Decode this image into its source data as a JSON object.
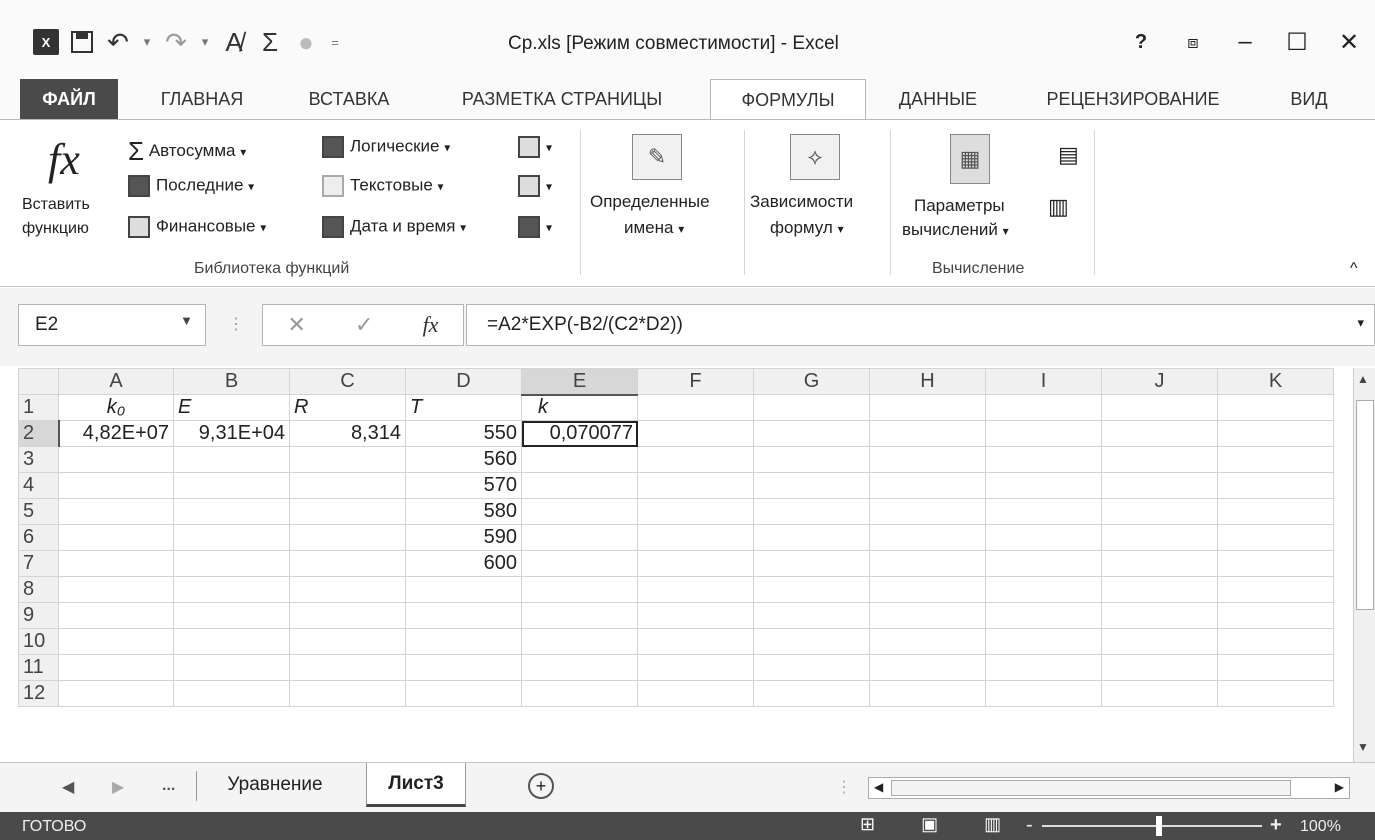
{
  "window": {
    "title": "Ср.xls  [Режим совместимости] - Excel",
    "help": "?",
    "restore_ribbon": "⧈",
    "minimize": "–",
    "maximize": "☐",
    "close": "✕"
  },
  "qat": {
    "logo": "X",
    "save": "💾",
    "undo": "↶",
    "redo": "↷",
    "spell": "A̸",
    "sum": "Σ",
    "circle": "●",
    "more": "="
  },
  "tabs": [
    "ФАЙЛ",
    "ГЛАВНАЯ",
    "ВСТАВКА",
    "РАЗМЕТКА СТРАНИЦЫ",
    "ФОРМУЛЫ",
    "ДАННЫЕ",
    "РЕЦЕНЗИРОВАНИЕ",
    "ВИД"
  ],
  "ribbon": {
    "insert_fn_line1": "Вставить",
    "insert_fn_line2": "функцию",
    "fx": "fx",
    "autosum": "Автосумма",
    "recent": "Последние",
    "financial": "Финансовые",
    "logical": "Логические",
    "text": "Текстовые",
    "datetime": "Дата и время",
    "group_library": "Библиотека функций",
    "defined_names_1": "Определенные",
    "defined_names_2": "имена",
    "dependencies_1": "Зависимости",
    "dependencies_2": "формул",
    "calc_params_1": "Параметры",
    "calc_params_2": "вычислений",
    "group_calc": "Вычисление",
    "collapse": "^"
  },
  "formula_bar": {
    "name_box": "E2",
    "formula": "=A2*EXP(-B2/(C2*D2))",
    "fx": "fx",
    "cancel": "✕",
    "enter": "✓"
  },
  "grid": {
    "columns": [
      "A",
      "B",
      "C",
      "D",
      "E",
      "F",
      "G",
      "H",
      "I",
      "J",
      "K"
    ],
    "rows": [
      [
        "k₀",
        "E",
        "R",
        "T",
        "k",
        "",
        "",
        "",
        "",
        "",
        ""
      ],
      [
        "4,82E+07",
        "9,31E+04",
        "8,314",
        "550",
        "0,070077",
        "",
        "",
        "",
        "",
        "",
        ""
      ],
      [
        "",
        "",
        "",
        "560",
        "",
        "",
        "",
        "",
        "",
        "",
        ""
      ],
      [
        "",
        "",
        "",
        "570",
        "",
        "",
        "",
        "",
        "",
        "",
        ""
      ],
      [
        "",
        "",
        "",
        "580",
        "",
        "",
        "",
        "",
        "",
        "",
        ""
      ],
      [
        "",
        "",
        "",
        "590",
        "",
        "",
        "",
        "",
        "",
        "",
        ""
      ],
      [
        "",
        "",
        "",
        "600",
        "",
        "",
        "",
        "",
        "",
        "",
        ""
      ],
      [
        "",
        "",
        "",
        "",
        "",
        "",
        "",
        "",
        "",
        "",
        ""
      ],
      [
        "",
        "",
        "",
        "",
        "",
        "",
        "",
        "",
        "",
        "",
        ""
      ],
      [
        "",
        "",
        "",
        "",
        "",
        "",
        "",
        "",
        "",
        "",
        ""
      ],
      [
        "",
        "",
        "",
        "",
        "",
        "",
        "",
        "",
        "",
        "",
        ""
      ],
      [
        "",
        "",
        "",
        "",
        "",
        "",
        "",
        "",
        "",
        "",
        ""
      ]
    ]
  },
  "sheets": {
    "ellipsis": "...",
    "tab1": "Уравнение",
    "tab2": "Лист3",
    "add": "+"
  },
  "status": {
    "text": "ГОТОВО",
    "zoom": "100%",
    "minus": "-",
    "plus": "+"
  }
}
